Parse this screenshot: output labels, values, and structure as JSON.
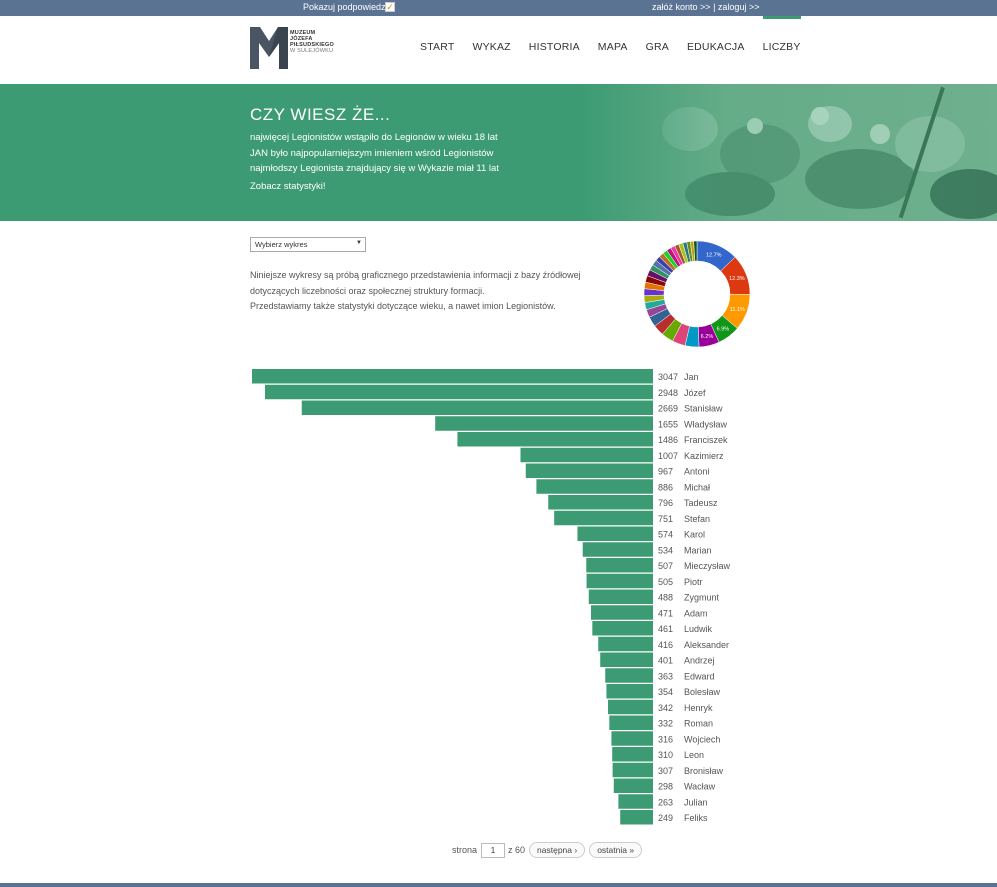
{
  "topbar": {
    "hints_label": "Pokazuj podpowiedzi",
    "hints_checked": "✓",
    "register": "załóż konto >>",
    "separator": "|",
    "login": "zaloguj >>"
  },
  "logo": {
    "line1": "MUZEUM",
    "line2": "JÓZEFA",
    "line3": "PIŁSUDSKIEGO",
    "line4": "W SULEJÓWKU"
  },
  "nav": {
    "items": [
      {
        "label": "START"
      },
      {
        "label": "WYKAZ"
      },
      {
        "label": "HISTORIA"
      },
      {
        "label": "MAPA"
      },
      {
        "label": "GRA"
      },
      {
        "label": "EDUKACJA"
      },
      {
        "label": "LICZBY"
      }
    ]
  },
  "banner": {
    "title": "CZY WIESZ ŻE...",
    "facts": [
      "najwięcej Legionistów wstąpiło do Legionów w wieku 18 lat",
      "JAN było najpopularniejszym imieniem wśród Legionistów",
      "najmłodszy Legionista znajdujący się w Wykazie miał 11 lat"
    ],
    "link": "Zobacz statystyki!"
  },
  "select": {
    "value": "Wybierz wykres"
  },
  "intro": {
    "line1": "Niniejsze wykresy są próbą graficznego przedstawienia informacji z bazy źródłowej",
    "line2": "dotyczących liczebności oraz społecznej struktury formacji.",
    "line3": "Przedstawiamy także statystyki dotyczące wieku, a nawet imion Legionistów."
  },
  "colors": {
    "accent": "#3c9b72",
    "topbar": "#5b7392"
  },
  "chart_data": [
    {
      "type": "pie",
      "variant": "donut",
      "labels_shown": [
        "12.7%",
        "12.3%",
        "11.1%",
        "6.9%",
        "6.2%"
      ],
      "values": [
        12.7,
        12.3,
        11.1,
        6.9,
        6.2,
        4.2,
        4.0,
        3.7,
        3.3,
        3.1,
        2.4,
        2.2,
        2.1,
        2.1,
        2.0,
        2.0,
        1.9,
        1.7,
        1.7,
        1.5,
        1.5,
        1.4,
        1.4,
        1.3,
        1.3,
        1.3,
        1.2,
        1.1,
        1.0,
        1.0
      ],
      "colors": [
        "#3366cc",
        "#dc3912",
        "#ff9900",
        "#109618",
        "#990099",
        "#0099c6",
        "#dd4477",
        "#66aa00",
        "#b82e2e",
        "#316395",
        "#994499",
        "#22aa99",
        "#aaaa11",
        "#6633cc",
        "#e67300",
        "#8b0707",
        "#651067",
        "#329262",
        "#5574a6",
        "#3b3eac",
        "#b77322",
        "#16d620",
        "#b91383",
        "#f4359e",
        "#9c5935",
        "#a9c413",
        "#2a778d",
        "#668d1c",
        "#bea413",
        "#0c5922"
      ]
    },
    {
      "type": "bar",
      "orientation": "horizontal",
      "categories": [
        "Jan",
        "Józef",
        "Stanisław",
        "Władysław",
        "Franciszek",
        "Kazimierz",
        "Antoni",
        "Michał",
        "Tadeusz",
        "Stefan",
        "Karol",
        "Marian",
        "Mieczysław",
        "Piotr",
        "Zygmunt",
        "Adam",
        "Ludwik",
        "Aleksander",
        "Andrzej",
        "Edward",
        "Bolesław",
        "Henryk",
        "Roman",
        "Wojciech",
        "Leon",
        "Bronisław",
        "Wacław",
        "Julian",
        "Feliks"
      ],
      "values": [
        3047,
        2948,
        2669,
        1655,
        1486,
        1007,
        967,
        886,
        796,
        751,
        574,
        534,
        507,
        505,
        488,
        471,
        461,
        416,
        401,
        363,
        354,
        342,
        332,
        316,
        310,
        307,
        298,
        263,
        249
      ],
      "color": "#3c9b72"
    }
  ],
  "pager": {
    "prefix": "strona",
    "current": "1",
    "of": "z 60",
    "next": "następna ›",
    "last": "ostatnia »"
  }
}
